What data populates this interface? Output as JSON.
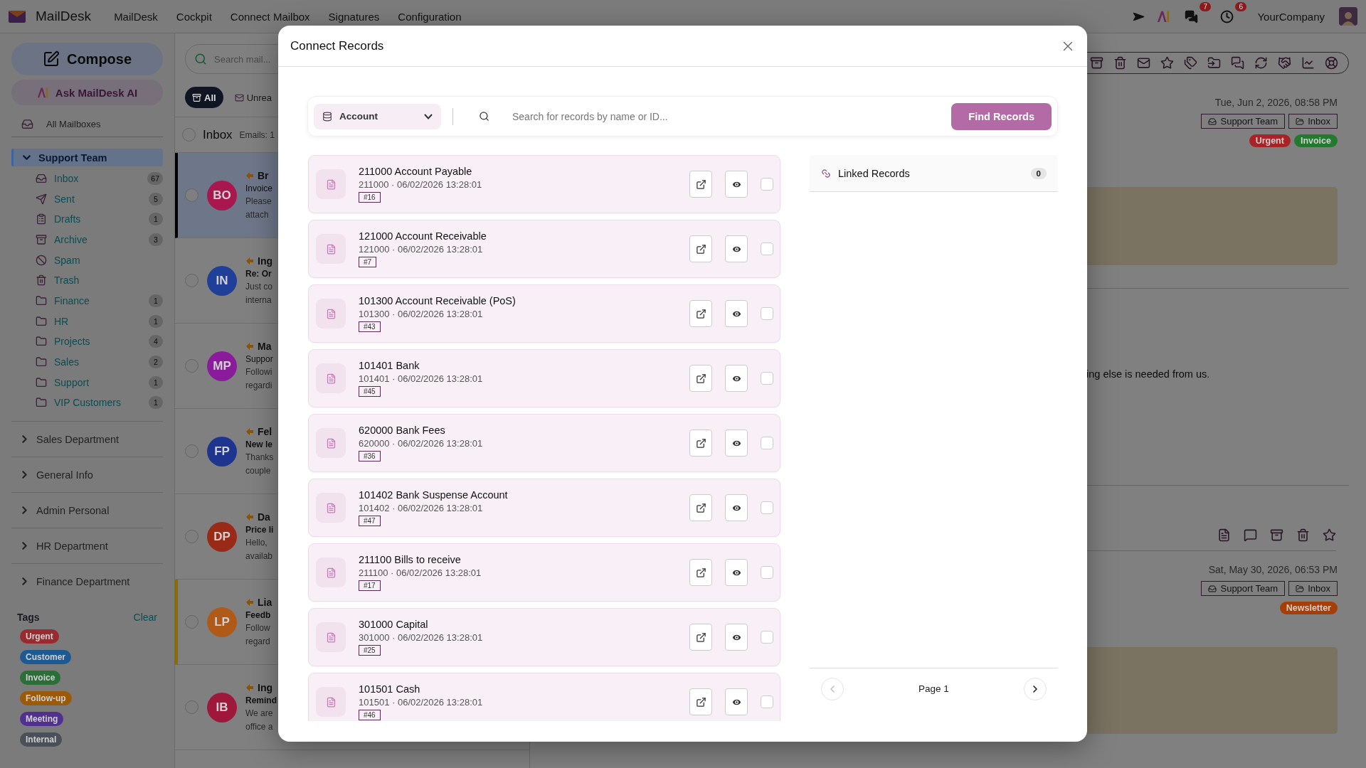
{
  "topbar": {
    "brand": "MailDesk",
    "menu": [
      "MailDesk",
      "Cockpit",
      "Connect Mailbox",
      "Signatures",
      "Configuration"
    ],
    "notifications": [
      {
        "kind": "chat",
        "count": "7"
      },
      {
        "kind": "activity",
        "count": "6"
      }
    ],
    "company": "YourCompany"
  },
  "sidebar": {
    "compose": "Compose",
    "ask_ai": "Ask MailDesk AI",
    "all_mailboxes": "All Mailboxes",
    "mailboxes": [
      {
        "name": "Support Team",
        "expanded": true,
        "folders": [
          {
            "name": "Inbox",
            "kind": "inbox",
            "count": "67"
          },
          {
            "name": "Sent",
            "kind": "sent",
            "count": "5"
          },
          {
            "name": "Drafts",
            "kind": "drafts",
            "count": "1"
          },
          {
            "name": "Archive",
            "kind": "archive",
            "count": "3"
          },
          {
            "name": "Spam",
            "kind": "spam"
          },
          {
            "name": "Trash",
            "kind": "trash"
          },
          {
            "name": "Finance",
            "kind": "folder",
            "count": "1"
          },
          {
            "name": "HR",
            "kind": "folder",
            "count": "1"
          },
          {
            "name": "Projects",
            "kind": "folder",
            "count": "4"
          },
          {
            "name": "Sales",
            "kind": "folder",
            "count": "2"
          },
          {
            "name": "Support",
            "kind": "folder",
            "count": "1"
          },
          {
            "name": "VIP Customers",
            "kind": "folder",
            "count": "1"
          }
        ]
      },
      {
        "name": "Sales Department",
        "expanded": false
      },
      {
        "name": "General Info",
        "expanded": false
      },
      {
        "name": "Admin Personal",
        "expanded": false
      },
      {
        "name": "HR Department",
        "expanded": false
      },
      {
        "name": "Finance Department",
        "expanded": false
      }
    ],
    "tags_title": "Tags",
    "clear": "Clear",
    "tags": [
      {
        "label": "Urgent",
        "color": "#9a2a2e"
      },
      {
        "label": "Customer",
        "color": "#1e5a92"
      },
      {
        "label": "Invoice",
        "color": "#2a6e38"
      },
      {
        "label": "Follow-up",
        "color": "#9a5a08"
      },
      {
        "label": "Meeting",
        "color": "#523090"
      },
      {
        "label": "Internal",
        "color": "#4a5058"
      }
    ]
  },
  "mail_list": {
    "search_placeholder": "Search mail...",
    "filters": [
      {
        "label": "All",
        "selected": true
      },
      {
        "label": "Unrea",
        "selected": false
      }
    ],
    "select_all_checked": false,
    "folder_title": "Inbox",
    "email_count": "Emails: 1",
    "emails": [
      {
        "initials": "BO",
        "color": "#a8174e",
        "sender": "Br",
        "subject": "Invoice",
        "preview": [
          "Please",
          "attach"
        ],
        "selected": true,
        "unread": false,
        "flagged": false
      },
      {
        "initials": "IN",
        "color": "#1f3f98",
        "sender": "Ing",
        "subject": "Re: Or",
        "preview": [
          "Just co",
          "interna"
        ],
        "selected": false,
        "unread": true,
        "flagged": false
      },
      {
        "initials": "MP",
        "color": "#8a1c9c",
        "sender": "Ma",
        "subject": "Suppor",
        "preview": [
          "Followi",
          "regardi"
        ],
        "selected": false,
        "unread": false,
        "flagged": false
      },
      {
        "initials": "FP",
        "color": "#1e3590",
        "sender": "Fel",
        "subject": "New le",
        "preview": [
          "Thanks",
          "couple"
        ],
        "selected": false,
        "unread": true,
        "flagged": false
      },
      {
        "initials": "DP",
        "color": "#9a2a18",
        "sender": "Da",
        "subject": "Price li",
        "preview": [
          "Hello,",
          "availab"
        ],
        "selected": false,
        "unread": true,
        "flagged": false
      },
      {
        "initials": "LP",
        "color": "#b05a1a",
        "sender": "Lia",
        "subject": "Feedb",
        "preview": [
          "Follow",
          "regard"
        ],
        "selected": false,
        "unread": true,
        "flagged": true
      },
      {
        "initials": "IB",
        "color": "#a0173c",
        "sender": "Ing",
        "subject": "Remind",
        "preview": [
          "We are",
          "office a"
        ],
        "selected": false,
        "unread": true,
        "flagged": false
      }
    ]
  },
  "reading": {
    "messages": [
      {
        "date": "Tue, Jun 2, 2026, 08:58 PM",
        "mailbox": "Support Team",
        "folder": "Inbox",
        "tags": [
          {
            "label": "Urgent",
            "color": "#a82226"
          },
          {
            "label": "Invoice",
            "color": "#237a2e"
          }
        ]
      },
      {
        "date": "Sat, May 30, 2026, 06:53 PM",
        "mailbox": "Support Team",
        "folder": "Inbox",
        "tags": [
          {
            "label": "Newsletter",
            "color": "#a83e05"
          }
        ]
      }
    ],
    "body_fragment": "ing else is needed from us."
  },
  "modal": {
    "title": "Connect Records",
    "model": "Account",
    "search_placeholder": "Search for records by name or ID...",
    "find_button": "Find Records",
    "records": [
      {
        "name": "211000 Account Payable",
        "meta": "211000 · 06/02/2026 13:28:01",
        "ref": "#16",
        "checked": false
      },
      {
        "name": "121000 Account Receivable",
        "meta": "121000 · 06/02/2026 13:28:01",
        "ref": "#7",
        "checked": false
      },
      {
        "name": "101300 Account Receivable (PoS)",
        "meta": "101300 · 06/02/2026 13:28:01",
        "ref": "#43",
        "checked": false
      },
      {
        "name": "101401 Bank",
        "meta": "101401 · 06/02/2026 13:28:01",
        "ref": "#45",
        "checked": false
      },
      {
        "name": "620000 Bank Fees",
        "meta": "620000 · 06/02/2026 13:28:01",
        "ref": "#36",
        "checked": false
      },
      {
        "name": "101402 Bank Suspense Account",
        "meta": "101402 · 06/02/2026 13:28:01",
        "ref": "#47",
        "checked": false
      },
      {
        "name": "211100 Bills to receive",
        "meta": "211100 · 06/02/2026 13:28:01",
        "ref": "#17",
        "checked": false
      },
      {
        "name": "301000 Capital",
        "meta": "301000 · 06/02/2026 13:28:01",
        "ref": "#25",
        "checked": false
      },
      {
        "name": "101501 Cash",
        "meta": "101501 · 06/02/2026 13:28:01",
        "ref": "#46",
        "checked": false
      }
    ],
    "linked": {
      "title": "Linked Records",
      "count": "0"
    },
    "pager": {
      "label": "Page 1",
      "prev_disabled": true,
      "next_disabled": false
    }
  }
}
